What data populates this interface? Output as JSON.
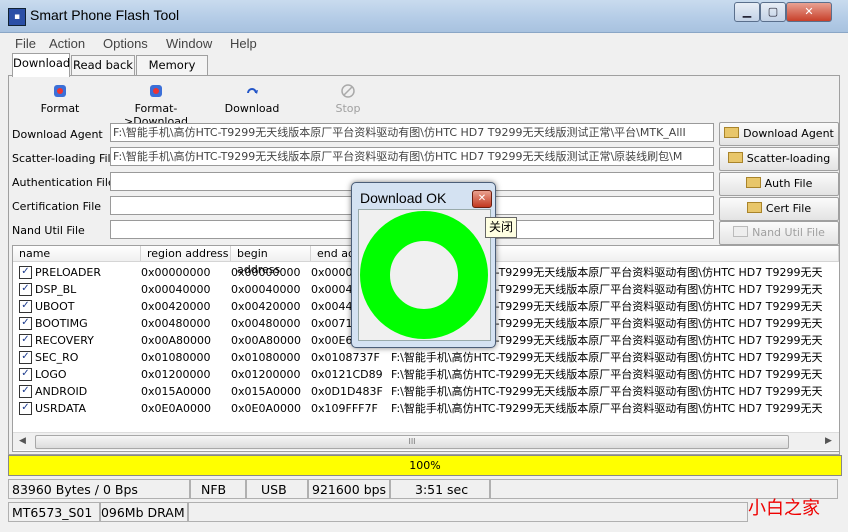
{
  "window": {
    "title": "Smart Phone Flash Tool"
  },
  "menu": [
    "File",
    "Action",
    "Options",
    "Window",
    "Help"
  ],
  "tabs": [
    "Download",
    "Read back",
    "Memory Test"
  ],
  "toolbar": {
    "format": "Format",
    "format_download": "Format->Download",
    "download": "Download",
    "stop": "Stop"
  },
  "files": {
    "download_agent": {
      "label": "Download Agent",
      "value": "F:\\智能手机\\高仿HTC-T9299无天线版本原厂平台资料驱动有图\\仿HTC HD7 T9299无天线版测试正常\\平台\\MTK_AllI",
      "button": "Download Agent"
    },
    "scatter": {
      "label": "Scatter-loading File",
      "value": "F:\\智能手机\\高仿HTC-T9299无天线版本原厂平台资料驱动有图\\仿HTC HD7 T9299无天线版测试正常\\原装线刷包\\M",
      "button": "Scatter-loading"
    },
    "auth": {
      "label": "Authentication File",
      "value": "",
      "button": "Auth File"
    },
    "cert": {
      "label": "Certification File",
      "value": "",
      "button": "Cert File"
    },
    "nand": {
      "label": "Nand Util File",
      "value": "",
      "button": "Nand Util File"
    }
  },
  "table": {
    "columns": [
      "name",
      "region address",
      "begin address",
      "end addr"
    ],
    "rows": [
      {
        "name": "PRELOADER",
        "region": "0x00000000",
        "begin": "0x00000000",
        "end": "0x0000E",
        "path": "F:\\智能手机\\高仿HTC-T9299无天线版本原厂平台资料驱动有图\\仿HTC HD7 T9299无天"
      },
      {
        "name": "DSP_BL",
        "region": "0x00040000",
        "begin": "0x00040000",
        "end": "0x00046",
        "path": "F:\\智能手机\\高仿HTC-T9299无天线版本原厂平台资料驱动有图\\仿HTC HD7 T9299无天"
      },
      {
        "name": "UBOOT",
        "region": "0x00420000",
        "begin": "0x00420000",
        "end": "0x00444",
        "path": "F:\\智能手机\\高仿HTC-T9299无天线版本原厂平台资料驱动有图\\仿HTC HD7 T9299无天"
      },
      {
        "name": "BOOTIMG",
        "region": "0x00480000",
        "begin": "0x00480000",
        "end": "0x00715",
        "path": "F:\\智能手机\\高仿HTC-T9299无天线版本原厂平台资料驱动有图\\仿HTC HD7 T9299无天"
      },
      {
        "name": "RECOVERY",
        "region": "0x00A80000",
        "begin": "0x00A80000",
        "end": "0x00E6E",
        "path": "F:\\智能手机\\高仿HTC-T9299无天线版本原厂平台资料驱动有图\\仿HTC HD7 T9299无天"
      },
      {
        "name": "SEC_RO",
        "region": "0x01080000",
        "begin": "0x01080000",
        "end": "0x0108737F",
        "path": "F:\\智能手机\\高仿HTC-T9299无天线版本原厂平台资料驱动有图\\仿HTC HD7 T9299无天"
      },
      {
        "name": "LOGO",
        "region": "0x01200000",
        "begin": "0x01200000",
        "end": "0x0121CD89",
        "path": "F:\\智能手机\\高仿HTC-T9299无天线版本原厂平台资料驱动有图\\仿HTC HD7 T9299无天"
      },
      {
        "name": "ANDROID",
        "region": "0x015A0000",
        "begin": "0x015A0000",
        "end": "0x0D1D483F",
        "path": "F:\\智能手机\\高仿HTC-T9299无天线版本原厂平台资料驱动有图\\仿HTC HD7 T9299无天"
      },
      {
        "name": "USRDATA",
        "region": "0x0E0A0000",
        "begin": "0x0E0A0000",
        "end": "0x109FFF7F",
        "path": "F:\\智能手机\\高仿HTC-T9299无天线版本原厂平台资料驱动有图\\仿HTC HD7 T9299无天"
      }
    ],
    "scroll_thumb": "III"
  },
  "progress": {
    "fraction": 1.0,
    "text": "100%",
    "color": "#ffff00"
  },
  "status": {
    "speed": "83960 Bytes / 0 Bps",
    "flash": "NFB",
    "port": "USB",
    "baud": "921600 bps",
    "time": "3:51 sec",
    "chip": "MT6573_S01",
    "dram": "4096Mb DRAM"
  },
  "dialog": {
    "title": "Download OK",
    "close_tooltip": "关闭",
    "ok_color": "#00ff00"
  },
  "watermark": "小白之家"
}
